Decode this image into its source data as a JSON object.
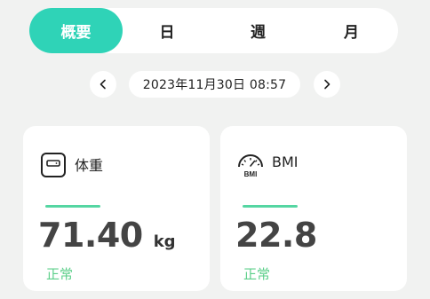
{
  "tabs": [
    {
      "label": "概要",
      "active": true
    },
    {
      "label": "日",
      "active": false
    },
    {
      "label": "週",
      "active": false
    },
    {
      "label": "月",
      "active": false
    }
  ],
  "date_nav": {
    "prev_icon": "chevron-left-icon",
    "next_icon": "chevron-right-icon",
    "datetime": "2023年11月30日 08:57"
  },
  "cards": {
    "weight": {
      "icon": "scale-icon",
      "title": "体重",
      "value": "71.40",
      "unit": "kg",
      "status": "正常"
    },
    "bmi": {
      "icon": "gauge-icon",
      "icon_text": "BMI",
      "title": "BMI",
      "value": "22.8",
      "status": "正常"
    }
  },
  "colors": {
    "active_tab": "#2fd3b7",
    "accent_line": "#55d6a2",
    "status_text": "#5ccf8a",
    "background": "#f1f2f1"
  }
}
